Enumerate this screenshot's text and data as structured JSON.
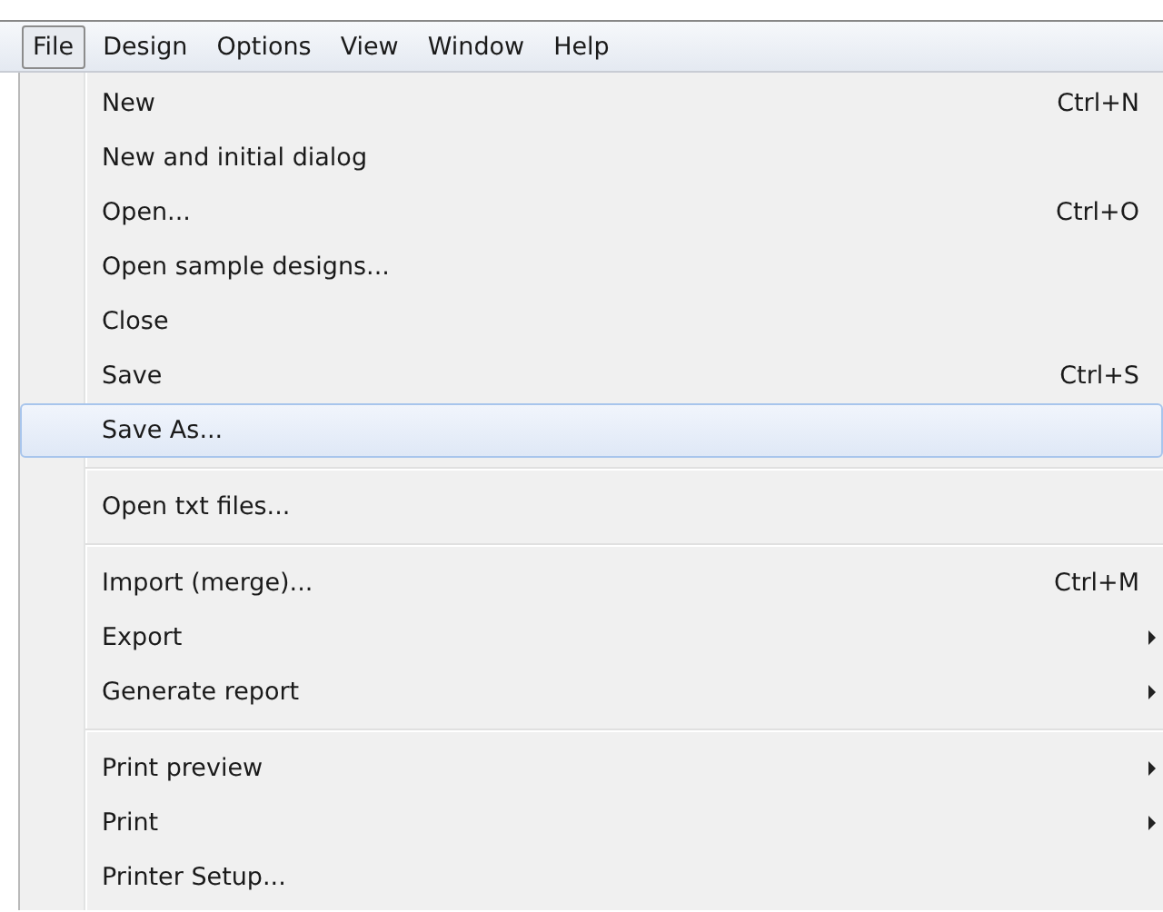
{
  "menubar": [
    {
      "label": "File",
      "selected": true
    },
    {
      "label": "Design",
      "selected": false
    },
    {
      "label": "Options",
      "selected": false
    },
    {
      "label": "View",
      "selected": false
    },
    {
      "label": "Window",
      "selected": false
    },
    {
      "label": "Help",
      "selected": false
    }
  ],
  "menu": [
    {
      "kind": "item",
      "label": "New",
      "shortcut": "Ctrl+N",
      "highlighted": false,
      "submenu": false
    },
    {
      "kind": "item",
      "label": "New and initial dialog",
      "highlighted": false,
      "submenu": false
    },
    {
      "kind": "item",
      "label": "Open...",
      "shortcut": "Ctrl+O",
      "highlighted": false,
      "submenu": false
    },
    {
      "kind": "item",
      "label": "Open sample designs...",
      "highlighted": false,
      "submenu": false
    },
    {
      "kind": "item",
      "label": "Close",
      "highlighted": false,
      "submenu": false
    },
    {
      "kind": "item",
      "label": "Save",
      "shortcut": "Ctrl+S",
      "highlighted": false,
      "submenu": false
    },
    {
      "kind": "item",
      "label": "Save As...",
      "highlighted": true,
      "submenu": false
    },
    {
      "kind": "separator"
    },
    {
      "kind": "item",
      "label": "Open txt files...",
      "highlighted": false,
      "submenu": false
    },
    {
      "kind": "separator"
    },
    {
      "kind": "item",
      "label": "Import (merge)...",
      "shortcut": "Ctrl+M",
      "highlighted": false,
      "submenu": false
    },
    {
      "kind": "item",
      "label": "Export",
      "highlighted": false,
      "submenu": true
    },
    {
      "kind": "item",
      "label": "Generate report",
      "highlighted": false,
      "submenu": true
    },
    {
      "kind": "separator"
    },
    {
      "kind": "item",
      "label": "Print preview",
      "highlighted": false,
      "submenu": true
    },
    {
      "kind": "item",
      "label": "Print",
      "highlighted": false,
      "submenu": true
    },
    {
      "kind": "item",
      "label": "Printer Setup...",
      "highlighted": false,
      "submenu": false
    }
  ]
}
